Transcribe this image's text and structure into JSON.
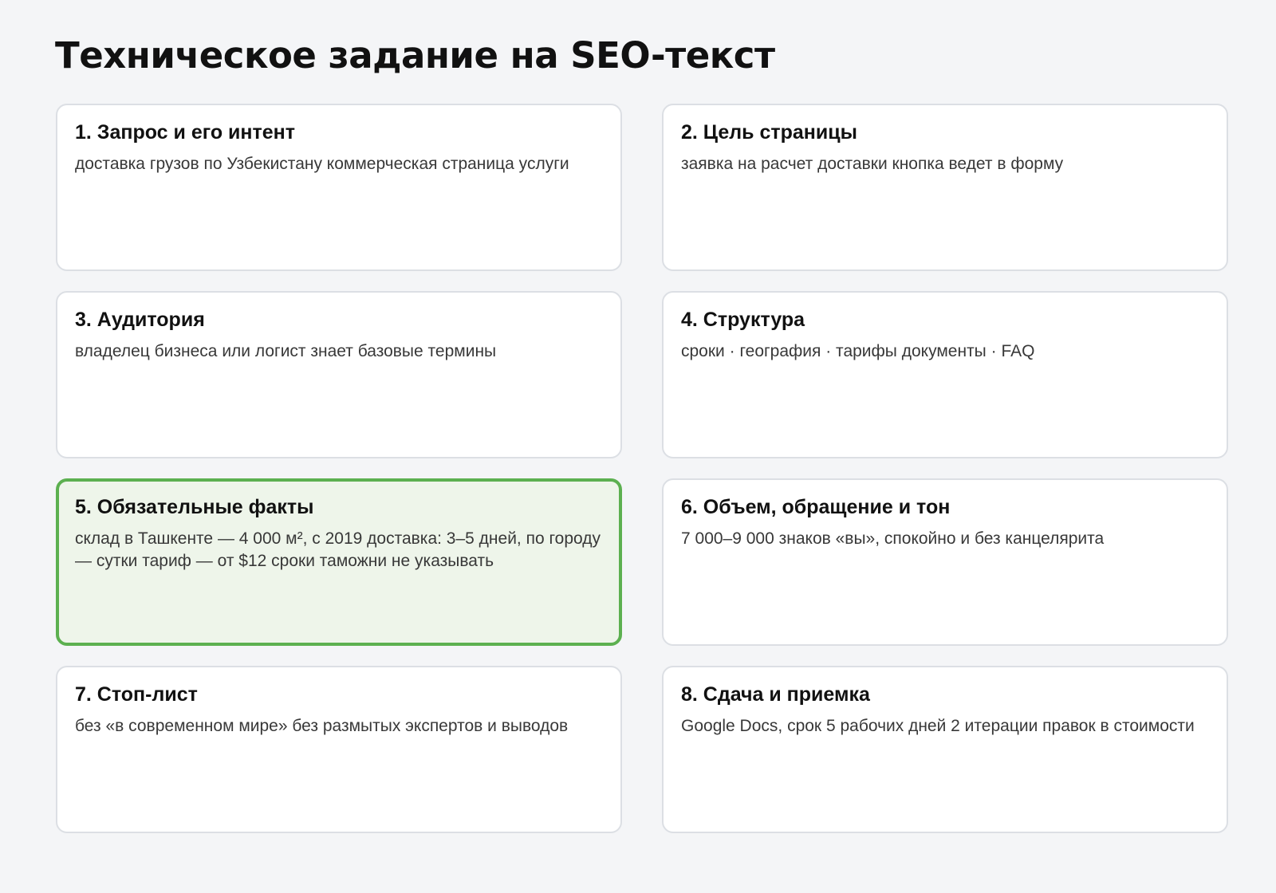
{
  "title": "Техническое задание на SEO-текст",
  "cards": [
    {
      "title": "1. Запрос и его интент",
      "text": "доставка грузов по Узбекистану коммерческая страница услуги",
      "highlighted": false
    },
    {
      "title": "2. Цель страницы",
      "text": "заявка на расчет доставки кнопка ведет в форму",
      "highlighted": false
    },
    {
      "title": "3. Аудитория",
      "text": "владелец бизнеса или логист знает базовые термины",
      "highlighted": false
    },
    {
      "title": "4. Структура",
      "text": "сроки · география · тарифы документы · FAQ",
      "highlighted": false
    },
    {
      "title": "5. Обязательные факты",
      "text": "склад в Ташкенте — 4 000 м², с 2019 доставка: 3–5 дней, по городу — сутки тариф — от $12 сроки таможни не указывать",
      "highlighted": true
    },
    {
      "title": "6. Объем, обращение и тон",
      "text": "7 000–9 000 знаков «вы», спокойно и без канцелярита",
      "highlighted": false
    },
    {
      "title": "7. Стоп-лист",
      "text": "без «в современном мире» без размытых экспертов и выводов",
      "highlighted": false
    },
    {
      "title": "8. Сдача и приемка",
      "text": "Google Docs, срок 5 рабочих дней 2 итерации правок в стоимости",
      "highlighted": false
    }
  ],
  "colors": {
    "background": "#f4f5f7",
    "card_border": "#dcdfe4",
    "highlight_border": "#5cb050",
    "highlight_background": "#eef5ea"
  }
}
